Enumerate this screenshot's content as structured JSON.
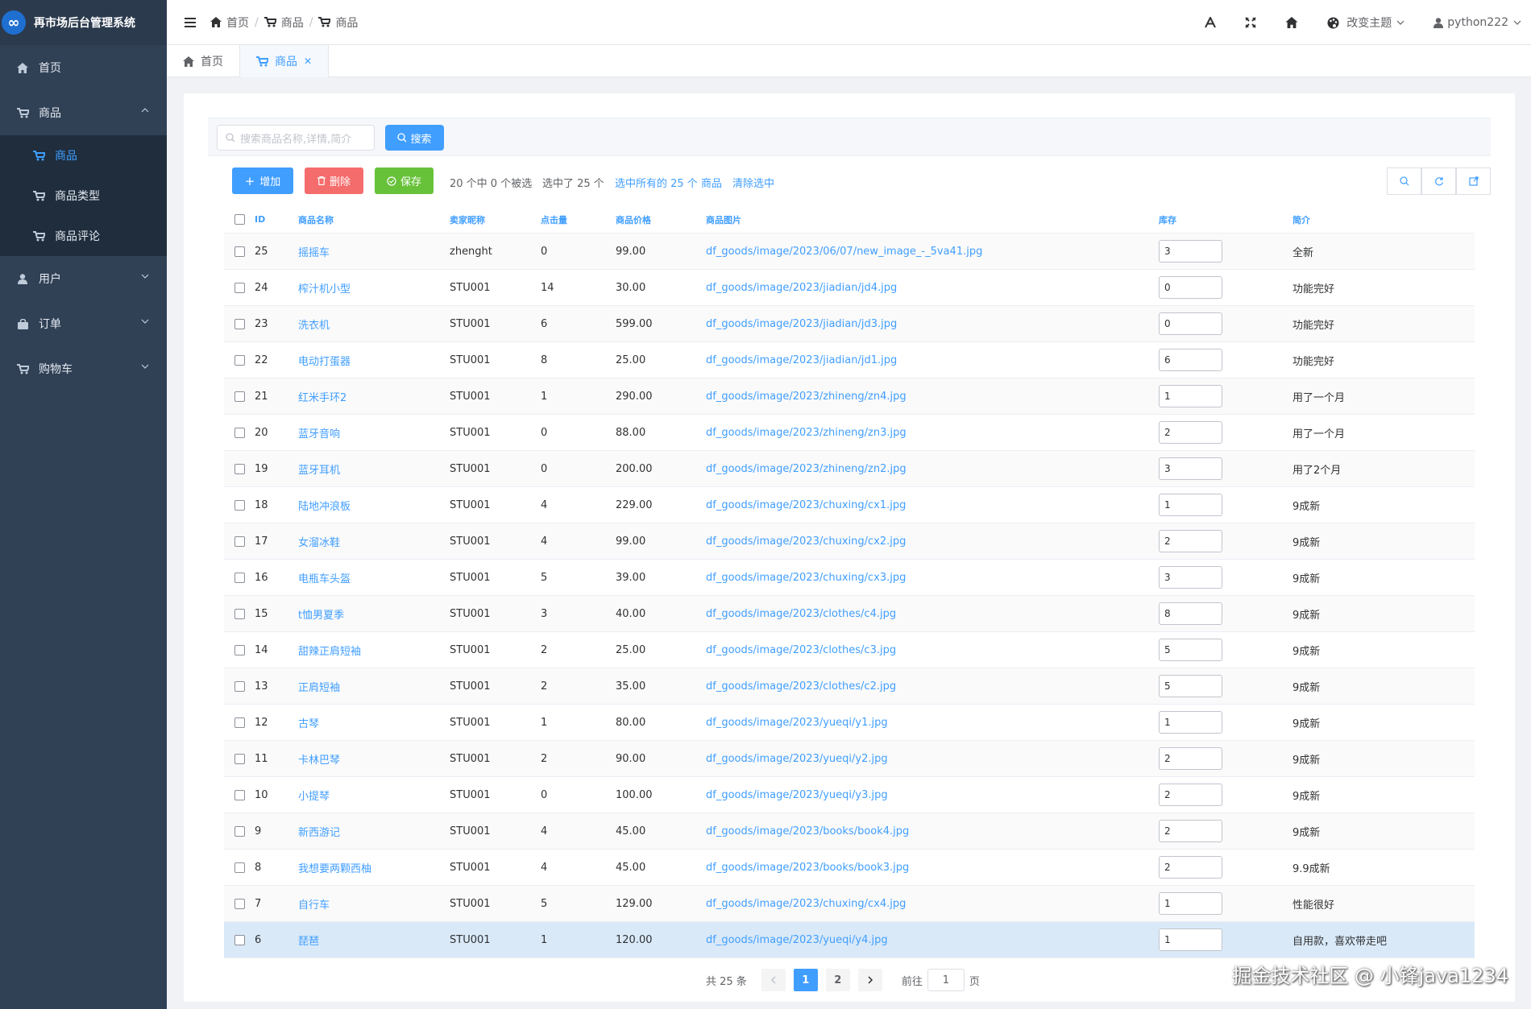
{
  "app": {
    "title": "再市场后台管理系统",
    "logo_text": "∞"
  },
  "sidebar": {
    "items": [
      {
        "label": "首页",
        "icon": "home-icon"
      },
      {
        "label": "商品",
        "icon": "cart-icon",
        "expanded": true,
        "children": [
          {
            "label": "商品",
            "active": true
          },
          {
            "label": "商品类型"
          },
          {
            "label": "商品评论"
          }
        ]
      },
      {
        "label": "用户",
        "icon": "user-icon"
      },
      {
        "label": "订单",
        "icon": "bag-icon"
      },
      {
        "label": "购物车",
        "icon": "cart-icon"
      }
    ]
  },
  "breadcrumb": [
    "首页",
    "商品",
    "商品"
  ],
  "topbar": {
    "theme_label": "改变主题",
    "username": "python222"
  },
  "tabs": [
    {
      "label": "首页"
    },
    {
      "label": "商品",
      "active": true
    }
  ],
  "search": {
    "placeholder": "搜索商品名称,详情,简介",
    "button": "搜索"
  },
  "toolbar": {
    "add": "增加",
    "delete": "删除",
    "save": "保存",
    "info1": "20 个中 0 个被选",
    "info2": "选中了 25 个",
    "select_all": "选中所有的 25 个 商品",
    "clear": "清除选中"
  },
  "table": {
    "headers": [
      "ID",
      "商品名称",
      "卖家昵称",
      "点击量",
      "商品价格",
      "商品图片",
      "库存",
      "简介"
    ],
    "rows": [
      {
        "id": "25",
        "name": "摇摇车",
        "seller": "zhenght",
        "clicks": "0",
        "price": "99.00",
        "image": "df_goods/image/2023/06/07/new_image_-_5va41.jpg",
        "stock": "3",
        "desc": "全新"
      },
      {
        "id": "24",
        "name": "榨汁机小型",
        "seller": "STU001",
        "clicks": "14",
        "price": "30.00",
        "image": "df_goods/image/2023/jiadian/jd4.jpg",
        "stock": "0",
        "desc": "功能完好"
      },
      {
        "id": "23",
        "name": "洗衣机",
        "seller": "STU001",
        "clicks": "6",
        "price": "599.00",
        "image": "df_goods/image/2023/jiadian/jd3.jpg",
        "stock": "0",
        "desc": "功能完好"
      },
      {
        "id": "22",
        "name": "电动打蛋器",
        "seller": "STU001",
        "clicks": "8",
        "price": "25.00",
        "image": "df_goods/image/2023/jiadian/jd1.jpg",
        "stock": "6",
        "desc": "功能完好"
      },
      {
        "id": "21",
        "name": "红米手环2",
        "seller": "STU001",
        "clicks": "1",
        "price": "290.00",
        "image": "df_goods/image/2023/zhineng/zn4.jpg",
        "stock": "1",
        "desc": "用了一个月"
      },
      {
        "id": "20",
        "name": "蓝牙音响",
        "seller": "STU001",
        "clicks": "0",
        "price": "88.00",
        "image": "df_goods/image/2023/zhineng/zn3.jpg",
        "stock": "2",
        "desc": "用了一个月"
      },
      {
        "id": "19",
        "name": "蓝牙耳机",
        "seller": "STU001",
        "clicks": "0",
        "price": "200.00",
        "image": "df_goods/image/2023/zhineng/zn2.jpg",
        "stock": "3",
        "desc": "用了2个月"
      },
      {
        "id": "18",
        "name": "陆地冲浪板",
        "seller": "STU001",
        "clicks": "4",
        "price": "229.00",
        "image": "df_goods/image/2023/chuxing/cx1.jpg",
        "stock": "1",
        "desc": "9成新"
      },
      {
        "id": "17",
        "name": "女溜冰鞋",
        "seller": "STU001",
        "clicks": "4",
        "price": "99.00",
        "image": "df_goods/image/2023/chuxing/cx2.jpg",
        "stock": "2",
        "desc": "9成新"
      },
      {
        "id": "16",
        "name": "电瓶车头盔",
        "seller": "STU001",
        "clicks": "5",
        "price": "39.00",
        "image": "df_goods/image/2023/chuxing/cx3.jpg",
        "stock": "3",
        "desc": "9成新"
      },
      {
        "id": "15",
        "name": "t恤男夏季",
        "seller": "STU001",
        "clicks": "3",
        "price": "40.00",
        "image": "df_goods/image/2023/clothes/c4.jpg",
        "stock": "8",
        "desc": "9成新"
      },
      {
        "id": "14",
        "name": "甜辣正肩短袖",
        "seller": "STU001",
        "clicks": "2",
        "price": "25.00",
        "image": "df_goods/image/2023/clothes/c3.jpg",
        "stock": "5",
        "desc": "9成新"
      },
      {
        "id": "13",
        "name": "正肩短袖",
        "seller": "STU001",
        "clicks": "2",
        "price": "35.00",
        "image": "df_goods/image/2023/clothes/c2.jpg",
        "stock": "5",
        "desc": "9成新"
      },
      {
        "id": "12",
        "name": "古琴",
        "seller": "STU001",
        "clicks": "1",
        "price": "80.00",
        "image": "df_goods/image/2023/yueqi/y1.jpg",
        "stock": "1",
        "desc": "9成新"
      },
      {
        "id": "11",
        "name": "卡林巴琴",
        "seller": "STU001",
        "clicks": "2",
        "price": "90.00",
        "image": "df_goods/image/2023/yueqi/y2.jpg",
        "stock": "2",
        "desc": "9成新"
      },
      {
        "id": "10",
        "name": "小提琴",
        "seller": "STU001",
        "clicks": "0",
        "price": "100.00",
        "image": "df_goods/image/2023/yueqi/y3.jpg",
        "stock": "2",
        "desc": "9成新"
      },
      {
        "id": "9",
        "name": "新西游记",
        "seller": "STU001",
        "clicks": "4",
        "price": "45.00",
        "image": "df_goods/image/2023/books/book4.jpg",
        "stock": "2",
        "desc": "9成新"
      },
      {
        "id": "8",
        "name": "我想要两颗西柚",
        "seller": "STU001",
        "clicks": "4",
        "price": "45.00",
        "image": "df_goods/image/2023/books/book3.jpg",
        "stock": "2",
        "desc": "9.9成新"
      },
      {
        "id": "7",
        "name": "自行车",
        "seller": "STU001",
        "clicks": "5",
        "price": "129.00",
        "image": "df_goods/image/2023/chuxing/cx4.jpg",
        "stock": "1",
        "desc": "性能很好"
      },
      {
        "id": "6",
        "name": "琵琶",
        "seller": "STU001",
        "clicks": "1",
        "price": "120.00",
        "image": "df_goods/image/2023/yueqi/y4.jpg",
        "stock": "1",
        "desc": "自用款，喜欢带走吧",
        "highlight": true
      }
    ]
  },
  "pagination": {
    "total": "共 25 条",
    "pages": [
      "1",
      "2"
    ],
    "current": "1",
    "goto_label": "前往",
    "goto_value": "1",
    "page_unit": "页"
  },
  "watermark": "掘金技术社区 @ 小锋java1234",
  "colors": {
    "sidebar": "#304156",
    "accent": "#409eff",
    "danger": "#f56c6c",
    "success": "#67c23a"
  }
}
